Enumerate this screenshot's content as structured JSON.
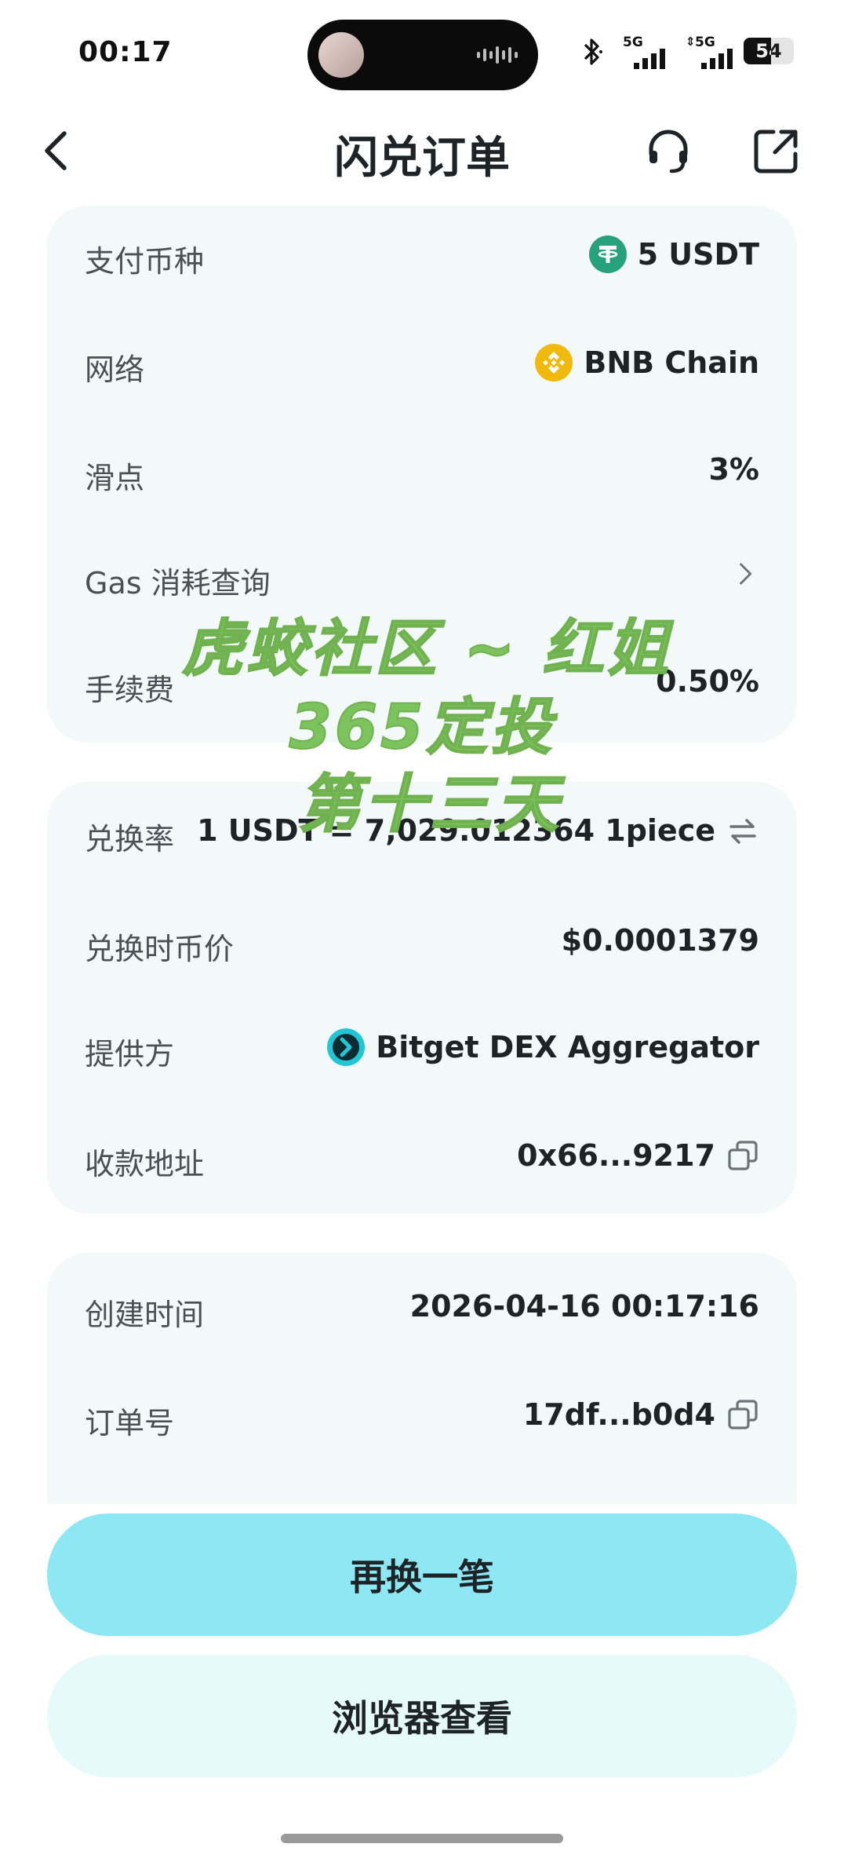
{
  "status_bar": {
    "time": "00:17",
    "network_1": "5G",
    "network_2": "5G",
    "battery": "54"
  },
  "nav": {
    "title": "闪兑订单"
  },
  "payment_card": {
    "rows": [
      {
        "label": "支付币种",
        "value": "5 USDT",
        "icon": "tether-icon"
      },
      {
        "label": "网络",
        "value": "BNB Chain",
        "icon": "bnb-icon"
      },
      {
        "label": "滑点",
        "value": "3%"
      },
      {
        "label": "Gas 消耗查询",
        "icon": "chevron-right-icon"
      },
      {
        "label": "手续费",
        "value": "0.50%"
      }
    ]
  },
  "exchange_card": {
    "rows": [
      {
        "label": "兑换率",
        "value": "1 USDT = 7,029.012364 1piece",
        "icon": "swap-icon"
      },
      {
        "label": "兑换时币价",
        "value": "$0.0001379"
      },
      {
        "label": "提供方",
        "value": "Bitget DEX Aggregator",
        "icon": "bitget-icon"
      },
      {
        "label": "收款地址",
        "value": "0x66...9217",
        "icon": "copy-icon"
      }
    ]
  },
  "order_card": {
    "rows": [
      {
        "label": "创建时间",
        "value": "2026-04-16 00:17:16"
      },
      {
        "label": "订单号",
        "value": "17df...b0d4",
        "icon": "copy-icon"
      }
    ]
  },
  "buttons": {
    "again": "再换一笔",
    "explorer": "浏览器查看"
  },
  "watermark": {
    "line1": "虎蛟社区 ~ 红姐",
    "line2": "365定投",
    "line3": "第十三天"
  },
  "colors": {
    "card_bg": "#f3f8f8",
    "primary_button": "#8ee8f4",
    "secondary_button": "#e6fafc",
    "watermark": "#7dc35d",
    "tether": "#26a17b",
    "bnb": "#f0b90b",
    "bitget": "#1fc7d4"
  }
}
